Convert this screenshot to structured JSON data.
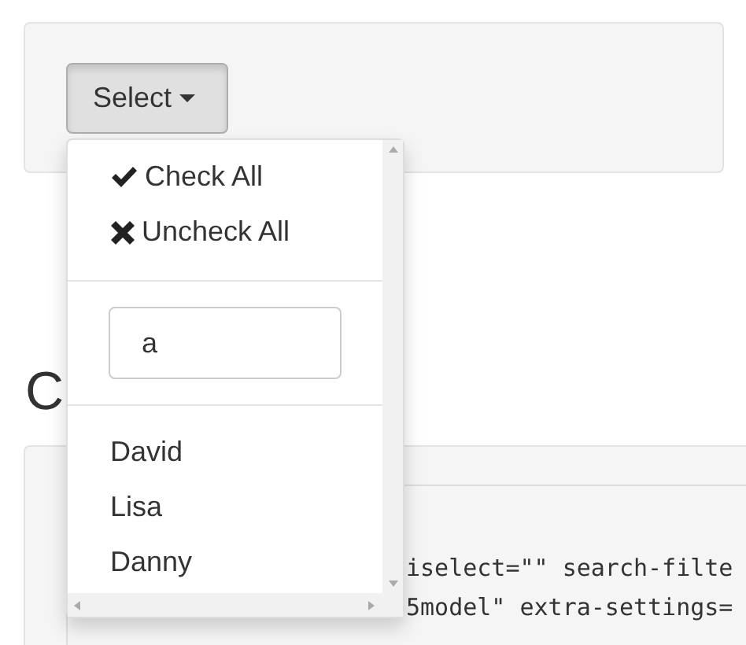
{
  "select_button": {
    "label": "Select"
  },
  "dropdown": {
    "actions": [
      {
        "kind": "check",
        "label": "Check All"
      },
      {
        "kind": "uncheck",
        "label": "Uncheck All"
      }
    ],
    "search": {
      "value": "a"
    },
    "options": [
      {
        "label": "David"
      },
      {
        "label": "Lisa"
      },
      {
        "label": "Danny"
      }
    ]
  },
  "heading": "C",
  "code_lines": [
    "iselect=\"\" search-filte",
    "5model\" extra-settings="
  ]
}
